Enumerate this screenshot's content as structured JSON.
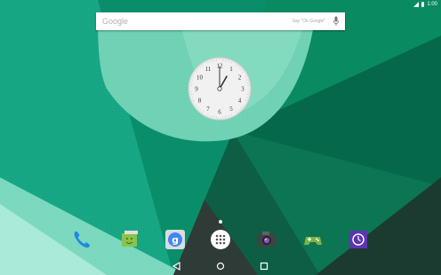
{
  "status_bar": {
    "time": "1:00",
    "icons": [
      "signal-icon",
      "battery-icon"
    ]
  },
  "search": {
    "brand": "Google",
    "hint": "Say \"Ok Google\"",
    "mic_icon": "microphone-icon"
  },
  "clock": {
    "hour": 1,
    "minute": 0,
    "numerals": [
      "12",
      "1",
      "2",
      "3",
      "4",
      "5",
      "6",
      "7",
      "8",
      "9",
      "10",
      "11"
    ]
  },
  "page_indicator": {
    "pages": 1,
    "current": 1
  },
  "dock": {
    "apps": [
      {
        "name": "phone-app",
        "icon": "phone-icon",
        "color": "#1e88e5"
      },
      {
        "name": "messenger-app",
        "icon": "messenger-icon",
        "color": "#8bc34a"
      },
      {
        "name": "google-app",
        "icon": "google-g-icon",
        "color": "#4285f4"
      },
      {
        "name": "app-drawer",
        "icon": "apps-grid-icon",
        "color": "#ffffff"
      },
      {
        "name": "camera-app",
        "icon": "camera-icon",
        "color": "#555555"
      },
      {
        "name": "play-games-app",
        "icon": "gamepad-icon",
        "color": "#7cb342"
      },
      {
        "name": "clock-app",
        "icon": "clock-icon",
        "color": "#5e35b1"
      }
    ]
  },
  "navigation": {
    "buttons": [
      "back-icon",
      "home-icon",
      "recents-icon"
    ]
  },
  "colors": {
    "wallpaper_base": "#009e77",
    "wallpaper_dark": "#0a7a57",
    "wallpaper_light": "#9ee3cc"
  }
}
